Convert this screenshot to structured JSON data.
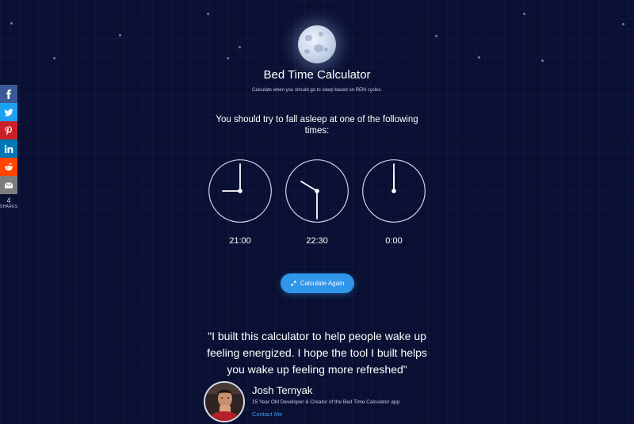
{
  "colors": {
    "background": "#0a1033",
    "accent": "#2f96ea",
    "link": "#3aa0f0",
    "facebook": "#3b5998",
    "twitter": "#1da1f2",
    "pinterest": "#cb2027",
    "linkedin": "#0077b5",
    "reddit": "#ff4500",
    "email": "#7d7d7d"
  },
  "share": {
    "buttons": [
      {
        "name": "facebook",
        "icon": "facebook-icon"
      },
      {
        "name": "twitter",
        "icon": "twitter-icon"
      },
      {
        "name": "pinterest",
        "icon": "pinterest-icon"
      },
      {
        "name": "linkedin",
        "icon": "linkedin-icon"
      },
      {
        "name": "reddit",
        "icon": "reddit-icon"
      },
      {
        "name": "email",
        "icon": "email-icon"
      }
    ],
    "count": "4",
    "count_label": "SHARES"
  },
  "header": {
    "moon_icon": "moon-icon",
    "title": "Bed Time Calculator",
    "subtitle": "Calculate when you should go to sleep based on REM cycles."
  },
  "results": {
    "prompt": "You should try to fall asleep at one of the following times:",
    "times": [
      "21:00",
      "22:30",
      "0:00"
    ]
  },
  "actions": {
    "calculate_again": "Calculate Again",
    "calculate_icon": "refresh-arrows-icon"
  },
  "testimonial": {
    "quote": "\"I built this calculator to help people wake up feeling energized. I hope the tool I built helps you wake up feeling more refreshed\"",
    "author_name": "Josh Ternyak",
    "author_role": "15 Year Old Developer & Creator of the Bed Time Calculator app",
    "contact_label": "Contact Me"
  }
}
